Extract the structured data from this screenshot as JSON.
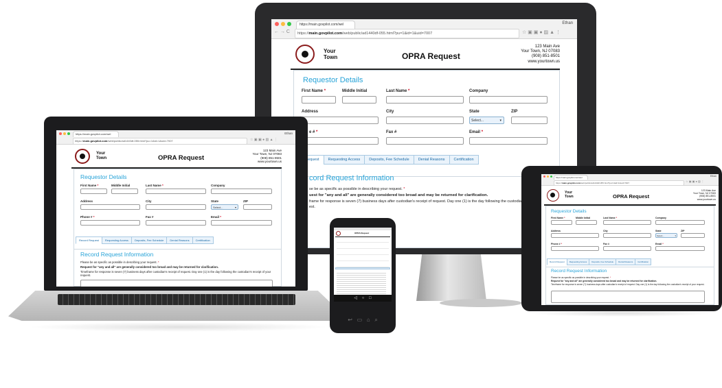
{
  "browser": {
    "tab_title": "https://main.govpilot.com/wel",
    "tab_title_short": "https://main.govpilot.com/wel",
    "url_host": "main.govpilot.com",
    "url_prefix": "https://",
    "url_path": "/web/public/ad1440df-055.html?pu=1&id=1&uid=7007",
    "user": "Ethan",
    "icons": [
      "back-icon",
      "forward-icon",
      "reload-icon",
      "secure-icon",
      "star-icon",
      "extension-icon",
      "menu-icon"
    ]
  },
  "form": {
    "town_line1": "Your",
    "town_line2": "Town",
    "title": "OPRA Request",
    "address": {
      "street": "123 Main Ave",
      "city": "Your Town, NJ 07083",
      "phone": "(908) 851-8501",
      "web": "www.yourtown.us"
    },
    "requestor_heading": "Requestor Details",
    "fields": {
      "first_name": "First Name",
      "middle_initial": "Middle Initial",
      "last_name": "Last Name",
      "company": "Company",
      "address": "Address",
      "city": "City",
      "state": "State",
      "zip": "ZIP",
      "phone": "Phone #",
      "fax": "Fax #",
      "email": "Email",
      "required_mark": "*",
      "state_select": "Select..."
    },
    "tabs": [
      "Record Request",
      "Requesting Access",
      "Deposits, Fee Schedule",
      "Denial Reasons",
      "Certification"
    ],
    "record_heading": "Record Request Information",
    "instructions": {
      "line1": "Please be as specific as possible in describing your request.",
      "line2": "Request for \"any and all\" are generally considered too broad and may be returned for clarification.",
      "line3": "Timeframe for response is seven (7) business days after custodian's receipt of request. Day one (1) is the day following the custodian's receipt of your request."
    }
  },
  "monitor": {
    "phone_cut": "e #",
    "tab_cut": "Request",
    "record_cut": "cord Request Information",
    "line1_cut": "se be as specific as possible in describing your request.",
    "line2_cut": "uest for \"any and all\" are generally considered too broad and may be returned for clarification.",
    "line3_cut": "frame for response is seven (7) business days after custodian's receipt of request. Day one (1) is the day following the custodian's re",
    "line4_cut": "est."
  },
  "phone_device": {
    "nav_icons": [
      "back-icon",
      "home-icon",
      "recents-icon"
    ],
    "softkey_icons": [
      "return-icon",
      "apps-icon",
      "home-button-icon",
      "search-icon"
    ],
    "nav_glyphs": [
      "◁",
      "○",
      "□"
    ],
    "softkey_glyphs": [
      "↩",
      "▭",
      "⌂",
      "⌕"
    ]
  },
  "colors": {
    "accent": "#27a3d8",
    "required": "#d0021b",
    "tab_text": "#1a6aa6",
    "device": "#1c1c1e"
  }
}
